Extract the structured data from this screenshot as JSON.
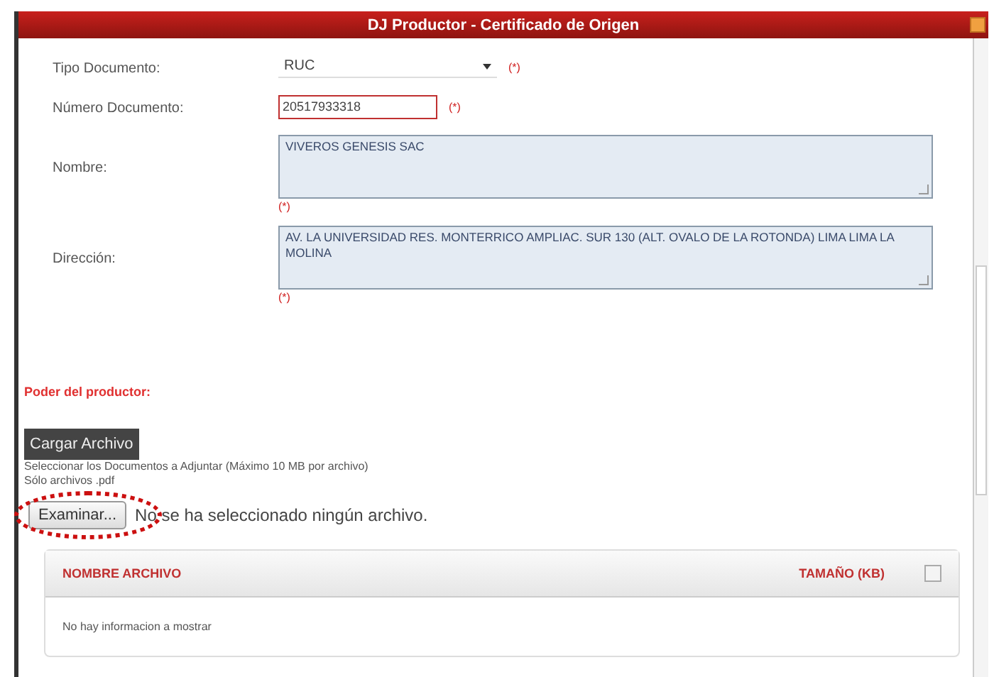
{
  "dialog": {
    "title": "DJ Productor - Certificado de Origen"
  },
  "fields": [
    {
      "kind": "select",
      "label": "Tipo Documento:",
      "value": "RUC",
      "required": "(*)"
    },
    {
      "kind": "input",
      "label": "Número Documento:",
      "value": "20517933318",
      "required": "(*)"
    },
    {
      "kind": "textarea",
      "label": "Nombre:",
      "value": "VIVEROS GENESIS SAC",
      "required": "(*)"
    },
    {
      "kind": "textarea",
      "label": "Dirección:",
      "value": "AV. LA UNIVERSIDAD RES. MONTERRICO AMPLIAC. SUR 130 (ALT. OVALO DE LA ROTONDA) LIMA LIMA LA MOLINA",
      "required": "(*)"
    }
  ],
  "section_title": "Poder del productor:",
  "upload_button": "Cargar Archivo",
  "hint": "Seleccionar los Documentos a Adjuntar (Máximo 10 MB por archivo)",
  "hint_2": "Sólo archivos .pdf",
  "browse_button": "Examinar...",
  "file_status": "No se ha seleccionado ningún archivo.",
  "highlight": true,
  "table": {
    "columns": [
      "NOMBRE ARCHIVO",
      "TAMAÑO (KB)"
    ],
    "select_all_checked": false,
    "empty_message": "No hay informacion a mostrar"
  }
}
